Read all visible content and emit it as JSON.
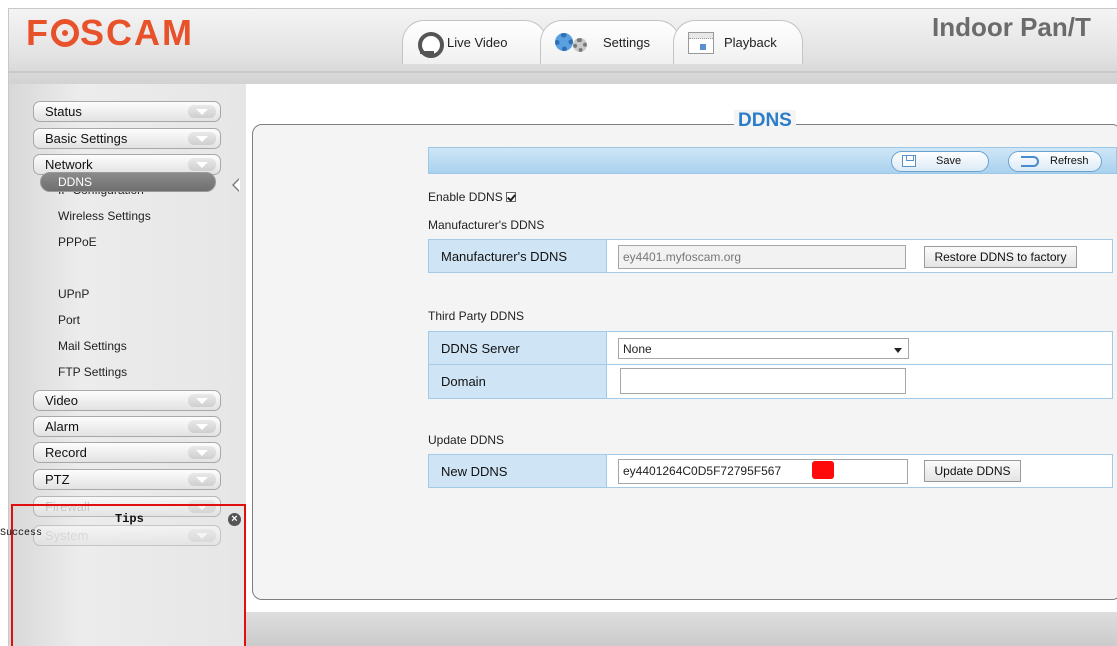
{
  "header": {
    "logo": "FOSCAM",
    "model_title": "Indoor Pan/T",
    "tabs": [
      {
        "label": "Live Video",
        "icon": "camera-icon"
      },
      {
        "label": "Settings",
        "icon": "gears-icon"
      },
      {
        "label": "Playback",
        "icon": "calendar-icon"
      }
    ]
  },
  "sidebar": {
    "menus_top": [
      "Status",
      "Basic Settings",
      "Network"
    ],
    "network_items": [
      "IP Configuration",
      "Wireless Settings",
      "PPPoE",
      "DDNS",
      "UPnP",
      "Port",
      "Mail Settings",
      "FTP Settings"
    ],
    "active_item": "DDNS",
    "menus_bottom": [
      "Video",
      "Alarm",
      "Record",
      "PTZ",
      "Firewall",
      "System"
    ]
  },
  "tips": {
    "title": "Tips",
    "message": "Success",
    "close_glyph": "×"
  },
  "page": {
    "title": "DDNS",
    "toolbar": {
      "save_label": "Save",
      "refresh_label": "Refresh"
    },
    "enable_ddns_label": "Enable DDNS",
    "enable_ddns_checked": true,
    "manufacturer_section": "Manufacturer's DDNS",
    "manufacturer_row_label": "Manufacturer's DDNS",
    "manufacturer_value": "ey4401.myfoscam.org",
    "restore_button": "Restore DDNS to factory",
    "third_party_section": "Third Party DDNS",
    "ddns_server_label": "DDNS Server",
    "ddns_server_value": "None",
    "domain_label": "Domain",
    "domain_value": "",
    "update_section": "Update DDNS",
    "new_ddns_label": "New DDNS",
    "new_ddns_value": "ey4401264C0D5F72795F567",
    "update_button": "Update DDNS"
  },
  "colors": {
    "brand": "#e8522b",
    "accent_blue": "#2a7dc9",
    "row_label_bg": "#cfe5f5",
    "tips_border": "#e01010"
  }
}
